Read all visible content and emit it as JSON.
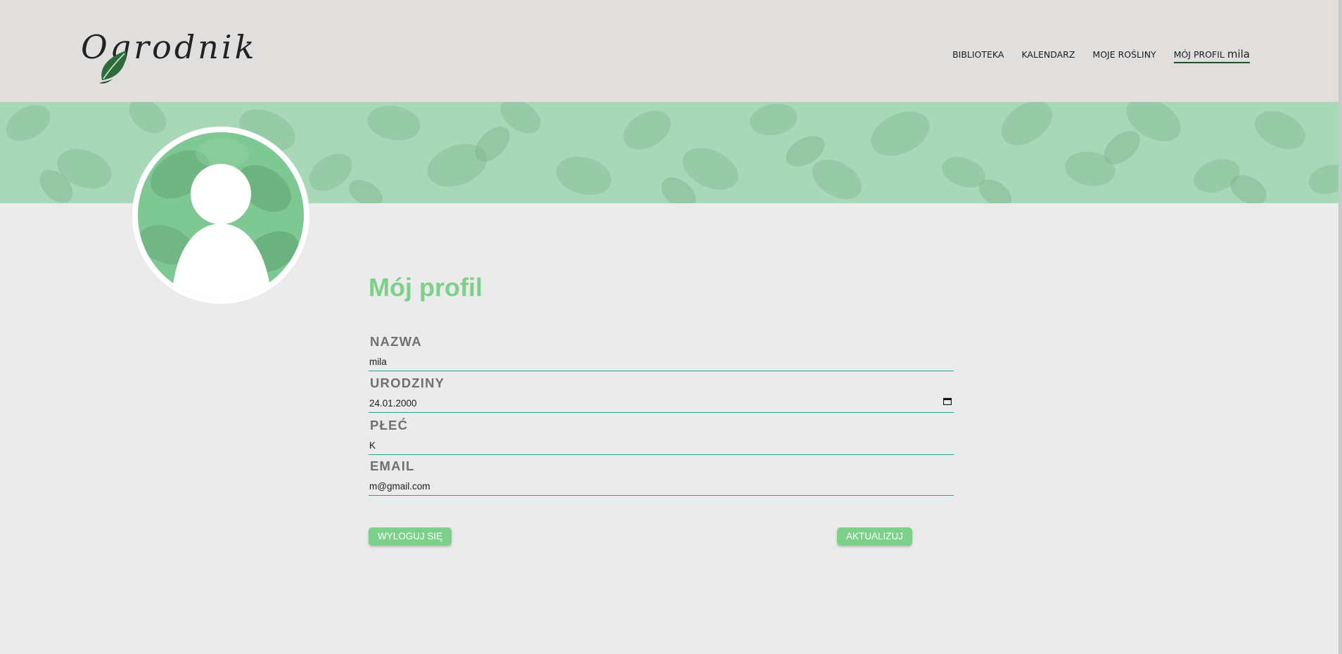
{
  "app": {
    "logo_text": "Ogrodnik"
  },
  "nav": {
    "items": [
      {
        "label": "BIBLIOTEKA"
      },
      {
        "label": "KALENDARZ"
      },
      {
        "label": "MOJE ROŚLINY"
      }
    ],
    "active_label": "MÓJ PROFIL",
    "username": "mila"
  },
  "profile": {
    "title": "Mój profil",
    "fields": {
      "name": {
        "label": "NAZWA",
        "value": "mila"
      },
      "birthday": {
        "label": "URODZINY",
        "value": "24.01.2000"
      },
      "gender": {
        "label": "PŁEĆ",
        "value": "K"
      },
      "email": {
        "label": "EMAIL",
        "value": "m@gmail.com"
      }
    },
    "logout_label": "WYLOGUJ SIĘ",
    "update_label": "AKTUALIZUJ"
  },
  "colors": {
    "accent": "#7dd08a",
    "header_bg": "#e0dfde",
    "banner_bg": "#a8d8b7",
    "underline": "#2e9c8e",
    "nav_active": "#1e4d2b"
  },
  "icons": {
    "logo_leaf": "leaf-icon",
    "birthday_picker": "calendar-icon",
    "avatar": "user-silhouette-icon"
  }
}
